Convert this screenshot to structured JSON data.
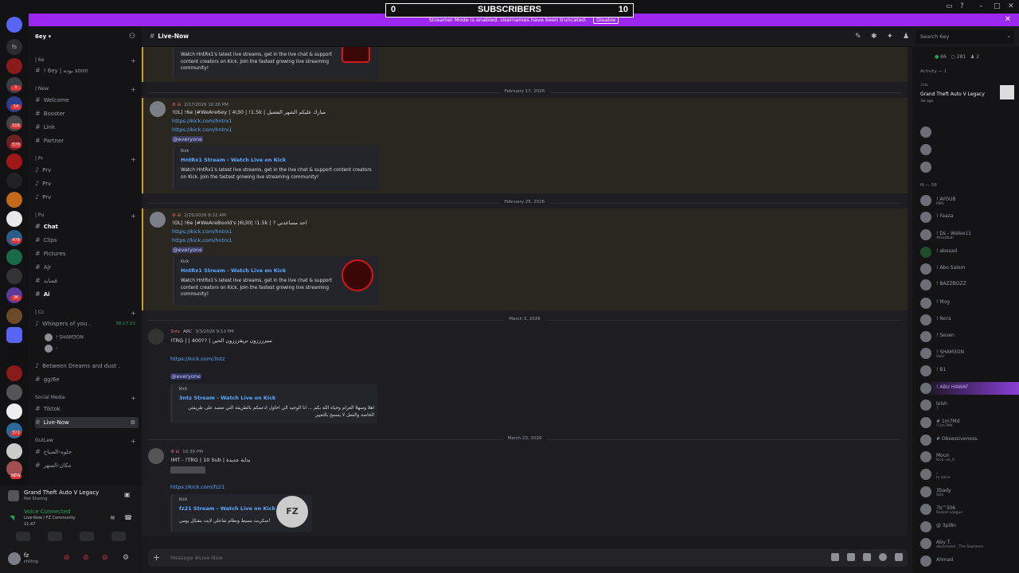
{
  "window": {
    "subscribers_label": "SUBSCRIBERS",
    "subscribers_left": "0",
    "subscribers_right": "10",
    "streamer_banner": "Streamer Mode is enabled. Usernames have been truncated.",
    "streamer_disable": "Disable"
  },
  "rail": {
    "badges": [
      "1",
      "14",
      "216",
      "570",
      "479",
      "36",
      "NEW",
      "372"
    ]
  },
  "sidebar": {
    "guild_name": "6ey",
    "categories": [
      {
        "label": "| 6e"
      },
      {
        "label": "| New"
      },
      {
        "label": "| Pr"
      },
      {
        "label": "| Pu"
      },
      {
        "label": "| Cc"
      },
      {
        "label": "Social Media"
      },
      {
        "label": "OutLaw"
      }
    ],
    "channels": [
      {
        "label": "! 6ey | بوده soon"
      },
      {
        "label": "Welcome"
      },
      {
        "label": "Booster"
      },
      {
        "label": "Link"
      },
      {
        "label": "Partner"
      },
      {
        "label": "Prv"
      },
      {
        "label": "Prv"
      },
      {
        "label": "Prv"
      },
      {
        "label": "Chat"
      },
      {
        "label": "Clips"
      },
      {
        "label": "Pictures"
      },
      {
        "label": "Ajr"
      },
      {
        "label": "قصايد"
      },
      {
        "label": "Ai"
      },
      {
        "label": "Whispers of you ."
      },
      {
        "label": "Between Dreams and dust ."
      },
      {
        "label": "gg/6e"
      },
      {
        "label": "Tiktok"
      },
      {
        "label": "Live-Now"
      },
      {
        "label": "جلوه-الصباح"
      },
      {
        "label": "مكان-السهر"
      }
    ],
    "voice_timer": "38:17:13",
    "voice_users": [
      "! SHAM3ON",
      "-"
    ]
  },
  "user_panel": {
    "activity_title": "Grand Theft Auto V Legacy",
    "activity_sub": "Not Sharing",
    "voice_status": "Voice Connected",
    "voice_channel": "Live-Now / FZ Community",
    "voice_time": "11:47",
    "user_name": "fz",
    "user_status": "chilling"
  },
  "chat": {
    "channel_name": "Live-Now",
    "composer_placeholder": "Message #Live-Now",
    "dividers": [
      "February 17, 2026",
      "February 25, 2026",
      "March 3, 2026",
      "March 23, 2026"
    ],
    "messages": [
      {
        "embed_desc": "Watch HntRx1's latest live streams, get in the live chat & support content creators on Kick. Join the fastest growing live streaming community!"
      },
      {
        "timestamp": "2/17/2026 10:26 PM",
        "text": "!OL| !6e |#WeAre6ey | 4\\30 | !1.5k | مبارك عليكم الشهر الفضيل",
        "links": [
          "https://kick.com/hntrx1",
          "https://kick.com/hntrx1"
        ],
        "mention": "@everyone",
        "embed_provider": "Kick",
        "embed_title": "HntRx1 Stream - Watch Live on Kick",
        "embed_desc": "Watch HntRx1's latest live streams, get in the live chat & support content creators on Kick. Join the fastest growing live streaming community!"
      },
      {
        "timestamp": "2/25/2026 8:22 AM",
        "text": "!OL| !6e |#WeAreBoold's |6\\30| !1.5k | ? احد مساعدني",
        "links": [
          "https://kick.com/hntrx1",
          "https://kick.com/hntrx1"
        ],
        "mention": "@everyone",
        "embed_provider": "Kick",
        "embed_title": "HntRx1 Stream - Watch Live on Kick",
        "embed_desc": "Watch HntRx1's latest live streams, get in the live chat & support content creators on Kick. Join the fastest growing live streaming community!"
      },
      {
        "author": "3ntz",
        "tag": "ARC",
        "timestamp": "3/3/2026 9:13 PM",
        "text": "!TRG | | 400?? | سيززززون تريقزززون الحين",
        "links": [
          "https://kick.com/3ntz"
        ],
        "mention": "@everyone",
        "embed_provider": "Kick",
        "embed_title": "3ntz Stream - Watch Live on Kick",
        "embed_desc": "اهلا وسهلا الغرام وحياه الله بكم ... انا الوحيد الي احاول ادعمكم بالطريقة التي تعتمد على طريقتي الخاصة والفعل لا يسمح بالتغيير"
      },
      {
        "timestamp": "10:39 PM",
        "text": "!MT - !TRG | 10 Sub | بداية جديدة",
        "links": [
          "https://kick.com/fz21"
        ],
        "embed_provider": "Kick",
        "embed_title": "fz21 Stream - Watch Live on Kick",
        "embed_desc": "سكربت بسيط ونظام تفاعلي لايت بشكل يومي!",
        "thumb_label": "FZ"
      }
    ]
  },
  "members": {
    "counts": [
      "66",
      "281",
      "2"
    ],
    "activity_header": "Activity — 1",
    "activity_user": "3ntz",
    "activity_game": "Grand Theft Auto V Legacy",
    "activity_time": "3w ago",
    "section_header": "M — 58",
    "list": [
      {
        "name": "! AYOUB",
        "sub": "MBS"
      },
      {
        "name": "! Faaza",
        "sub": ""
      },
      {
        "name": "! Ds - Walee11",
        "sub": "#Football"
      },
      {
        "name": "! abosad",
        "sub": ""
      },
      {
        "name": "! Abo Salem",
        "sub": ""
      },
      {
        "name": "! BAZZBOZZ",
        "sub": ""
      },
      {
        "name": "! Mog",
        "sub": ""
      },
      {
        "name": "! Nora",
        "sub": ""
      },
      {
        "name": "! Seven",
        "sub": ""
      },
      {
        "name": "! SHAM3ON",
        "sub": "UwU"
      },
      {
        "name": "! B1",
        "sub": ""
      },
      {
        "name": "! ABU HAWAF",
        "sub": ""
      },
      {
        "name": "lelsh",
        "sub": "7"
      },
      {
        "name": "# 1m7Md",
        "sub": "!!1m7Md"
      },
      {
        "name": "# Obsessiveness.",
        "sub": ""
      },
      {
        "name": "Moun",
        "sub": "Kick: ve_0"
      },
      {
        "name": "-",
        "sub": "In voice"
      },
      {
        "name": "3bady",
        "sub": "SOS"
      },
      {
        "name": "7b^306",
        "sub": "Rocket League"
      },
      {
        "name": "@ 3pl8n",
        "sub": ""
      },
      {
        "name": "Abu T.",
        "sub": "abo1meed , The Soprance"
      },
      {
        "name": "Ahmad",
        "sub": ""
      }
    ]
  },
  "colors": {
    "banner": "#9b27f0",
    "link": "#5aa9ff",
    "highlight_border": "#c89b2a",
    "mention_badge": "#da373c"
  }
}
